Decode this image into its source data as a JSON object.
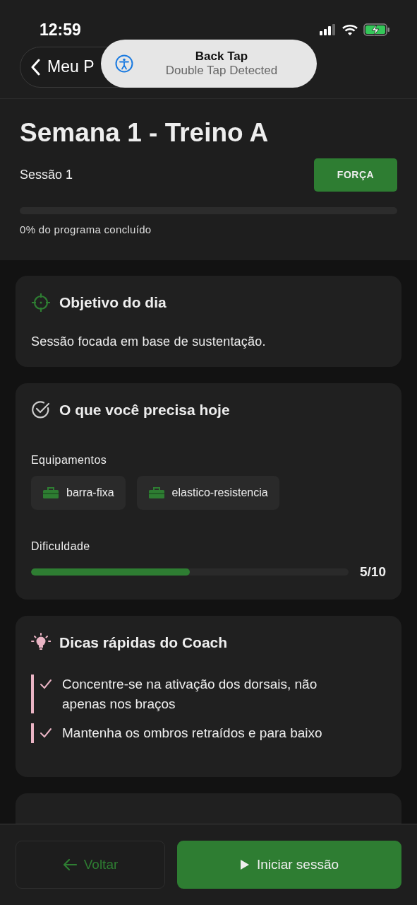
{
  "status_bar": {
    "time": "12:59"
  },
  "toast": {
    "title": "Back Tap",
    "subtitle": "Double Tap Detected"
  },
  "back_button": {
    "label": "Meu P"
  },
  "header": {
    "title": "Semana 1 - Treino A",
    "session": "Sessão 1",
    "badge": "FORÇA",
    "progress": {
      "level": 0,
      "caption": "0% do programa concluído"
    }
  },
  "cards": [
    {
      "kind": "objective",
      "title": "Objetivo do dia",
      "text": "Sessão focada em base de sustentação."
    },
    {
      "kind": "needs",
      "title": "O que você precisa hoje",
      "equipment_label": "Equipamentos",
      "equipment": [
        "barra-fixa",
        "elastico-resistencia"
      ],
      "difficulty_label": "Dificuldade",
      "difficulty": {
        "level": 0.5,
        "reading": "5/10"
      }
    },
    {
      "kind": "tips",
      "title": "Dicas rápidas do Coach",
      "tips": [
        "Concentre-se na ativação dos dorsais, não apenas nos braços",
        "Mantenha os ombros retraídos e para baixo"
      ]
    }
  ],
  "footer": {
    "back": "Voltar",
    "start": "Iniciar sessão"
  }
}
